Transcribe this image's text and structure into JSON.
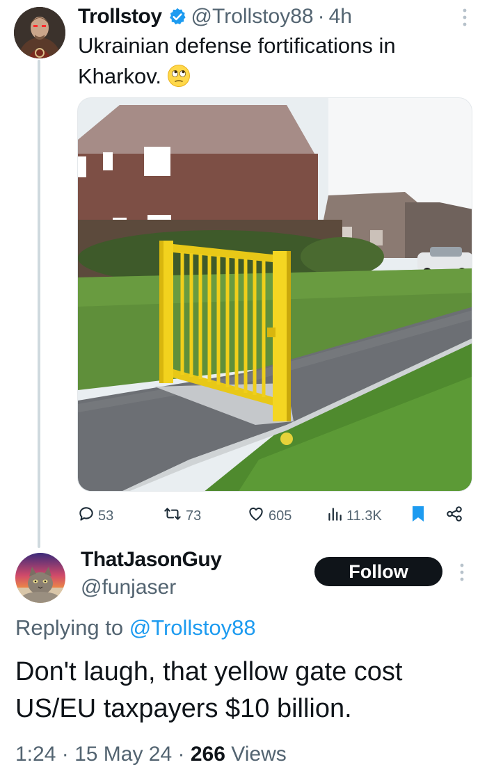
{
  "parent_tweet": {
    "author_name": "Trollstoy",
    "handle": "@Trollstoy88",
    "separator": "·",
    "time_ago": "4h",
    "text": "Ukrainian defense fortifications in Kharkov.",
    "emoji_icon": "rolling-eyes-emoji",
    "media_icon": "photo-yellow-gate-on-grass-path",
    "actions": {
      "replies": "53",
      "reposts": "73",
      "likes": "605",
      "views": "11.3K"
    },
    "colors": {
      "verified": "#1d9bf0",
      "bookmark_active": "#1d9bf0"
    }
  },
  "reply_tweet": {
    "author_name": "ThatJasonGuy",
    "handle": "@funjaser",
    "follow_label": "Follow",
    "replying_prefix": "Replying to",
    "replying_handle": "@Trollstoy88",
    "text": "Don't laugh, that yellow gate cost US/EU taxpayers $10 billion.",
    "time": "1:24",
    "date": "15 May 24",
    "separator": "·",
    "views_count": "266",
    "views_label": "Views"
  },
  "colors": {
    "text": "#0f1419",
    "secondary": "#536471",
    "accent": "#1d9bf0",
    "button_bg": "#0f1419"
  }
}
